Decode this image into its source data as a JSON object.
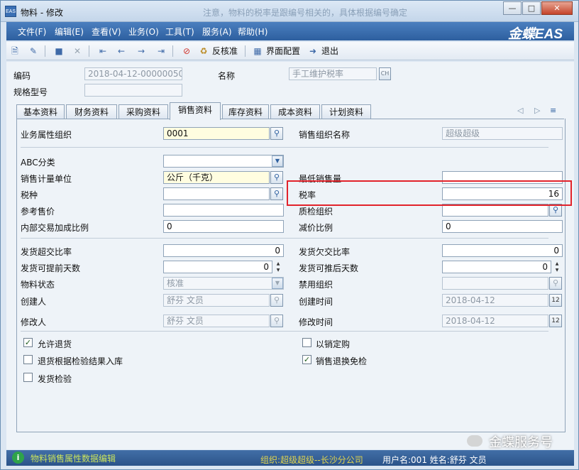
{
  "window": {
    "icon_text": "EAS",
    "title": "物料 - 修改",
    "title_ghost": "注意，物料的税率是跟编号相关的，具体根据编号确定"
  },
  "menu": [
    "文件(F)",
    "编辑(E)",
    "查看(V)",
    "业务(O)",
    "工具(T)",
    "服务(A)",
    "帮助(H)"
  ],
  "brand": "金蝶EAS",
  "toolbar": {
    "unaudit": "反核准",
    "ui_config": "界面配置",
    "exit": "退出"
  },
  "header": {
    "code_label": "编码",
    "code_value": "2018-04-12-00000050",
    "name_label": "名称",
    "name_value": "手工维护税率",
    "name_lang": "CH",
    "spec_label": "规格型号",
    "spec_value": ""
  },
  "tabs": [
    "基本资料",
    "财务资料",
    "采购资料",
    "销售资料",
    "库存资料",
    "成本资料",
    "计划资料"
  ],
  "active_tab": "销售资料",
  "form": {
    "biz_org_label": "业务属性组织",
    "biz_org_value": "0001",
    "sales_org_name_label": "销售组织名称",
    "sales_org_name_value": "超级超级",
    "abc_label": "ABC分类",
    "abc_value": "",
    "sales_unit_label": "销售计量单位",
    "sales_unit_value": "公斤（千克）",
    "min_sales_label": "最低销售量",
    "min_sales_value": "",
    "tax_type_label": "税种",
    "tax_type_value": "",
    "tax_rate_label": "税率",
    "tax_rate_value": "16",
    "ref_price_label": "参考售价",
    "ref_price_value": "",
    "qc_org_label": "质检组织",
    "qc_org_value": "",
    "markup_label": "内部交易加成比例",
    "markup_value": "0",
    "discount_label": "减价比例",
    "discount_value": "0",
    "over_ship_label": "发货超交比率",
    "over_ship_value": "0",
    "under_ship_label": "发货欠交比率",
    "under_ship_value": "0",
    "advance_days_label": "发货可提前天数",
    "advance_days_value": "0",
    "delay_days_label": "发货可推后天数",
    "delay_days_value": "0",
    "status_label": "物料状态",
    "status_value": "核准",
    "disable_org_label": "禁用组织",
    "disable_org_value": "",
    "creator_label": "创建人",
    "creator_value": "舒芬 文员",
    "created_time_label": "创建时间",
    "created_time_value": "2018-04-12",
    "modifier_label": "修改人",
    "modifier_value": "舒芬 文员",
    "modified_time_label": "修改时间",
    "modified_time_value": "2018-04-12"
  },
  "checkboxes": {
    "allow_return": {
      "label": "允许退货",
      "checked": true
    },
    "sell_by_order": {
      "label": "以销定购",
      "checked": false
    },
    "return_by_qc": {
      "label": "退货根据检验结果入库",
      "checked": false
    },
    "return_exempt": {
      "label": "销售退换免检",
      "checked": true
    },
    "ship_inspect": {
      "label": "发货检验",
      "checked": false
    }
  },
  "status": {
    "message": "物料销售属性数据编辑",
    "org": "组织:超级超级--长沙分公司",
    "user": "用户名:001  姓名:舒芬 文员"
  },
  "watermark": "金蝶服务号",
  "colors": {
    "menubar": "#2d5f9f",
    "highlight_box": "#e2232b",
    "required_bg": "#fffde0"
  }
}
